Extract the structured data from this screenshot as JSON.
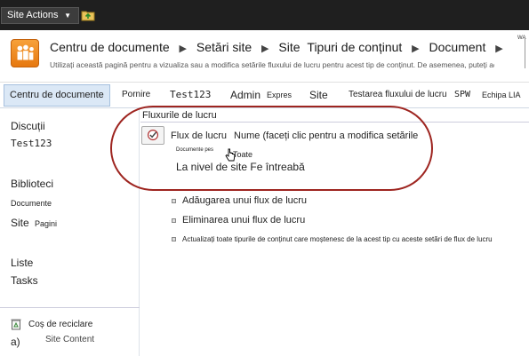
{
  "topbar": {
    "site_actions_label": "Site Actions",
    "dropdown_arrow": "▼"
  },
  "header": {
    "breadcrumbs": [
      "Centru de documente",
      "Setări site",
      "Site",
      "Tipuri de conținut",
      "Document"
    ],
    "description": "Utilizați această pagină pentru a vizualiza sau a modifica setările fluxului de lucru pentru acest tip de conținut. De asemenea, puteți adăuga",
    "right_label": "WA"
  },
  "nav": {
    "items": [
      "Centru de documente",
      "Pornire",
      "Test123",
      "Admin",
      "Expres",
      "Site",
      "Testarea fluxului de lucru",
      "SPW",
      "Echipa LIA"
    ]
  },
  "sidebar": {
    "discussions": "Discuții",
    "test": "Test123",
    "libraries": "Biblioteci",
    "documents": "Documente",
    "site": "Site",
    "pages": "Pagini",
    "lists": "Liste",
    "tasks": "Tasks",
    "recycle": "Coș de reciclare",
    "footer_letter": "a)",
    "footer_text": "Site Content"
  },
  "main": {
    "title": "Fluxurile de lucru",
    "workflow_label": "Flux de lucru",
    "workflow_name": "Nume (faceți clic pentru a modifica setările",
    "small_label": "Documente pes",
    "toate": "Toate",
    "level": "La nivel de site Fe întreabă",
    "actions": [
      "Adăugarea unui flux de lucru",
      "Eliminarea unui flux de lucru",
      "Actualizați toate tipurile de conținut care moștenesc de la acest tip cu aceste setări de flux de lucru"
    ]
  },
  "colors": {
    "highlight_oval": "#9e2520",
    "nav_active_bg": "#dbe8f6",
    "topbar_bg": "#1f1f1f"
  }
}
